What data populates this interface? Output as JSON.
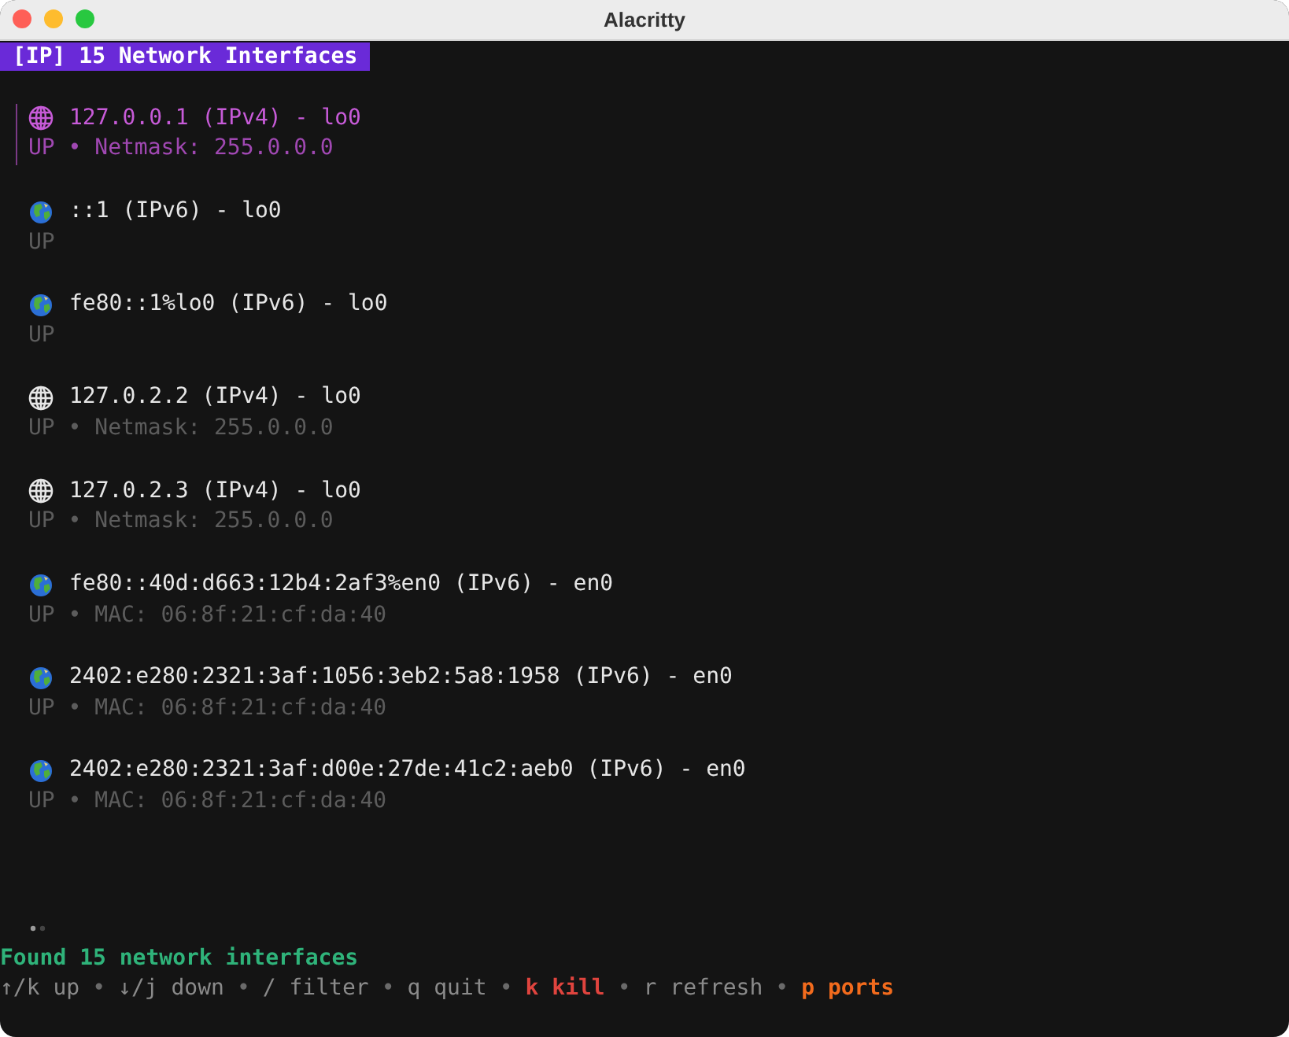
{
  "window": {
    "title": "Alacritty"
  },
  "header": "[IP] 15 Network Interfaces",
  "interfaces": [
    {
      "kind": "ipv4",
      "selected": true,
      "address": "127.0.0.1 (IPv4) - lo0",
      "status": "UP • Netmask: 255.0.0.0"
    },
    {
      "kind": "ipv6",
      "selected": false,
      "address": "::1 (IPv6) - lo0",
      "status": "UP"
    },
    {
      "kind": "ipv6",
      "selected": false,
      "address": "fe80::1%lo0 (IPv6) - lo0",
      "status": "UP"
    },
    {
      "kind": "ipv4",
      "selected": false,
      "address": "127.0.2.2 (IPv4) - lo0",
      "status": "UP • Netmask: 255.0.0.0"
    },
    {
      "kind": "ipv4",
      "selected": false,
      "address": "127.0.2.3 (IPv4) - lo0",
      "status": "UP • Netmask: 255.0.0.0"
    },
    {
      "kind": "ipv6",
      "selected": false,
      "address": "fe80::40d:d663:12b4:2af3%en0 (IPv6) - en0",
      "status": "UP • MAC: 06:8f:21:cf:da:40"
    },
    {
      "kind": "ipv6",
      "selected": false,
      "address": "2402:e280:2321:3af:1056:3eb2:5a8:1958 (IPv6) - en0",
      "status": "UP • MAC: 06:8f:21:cf:da:40"
    },
    {
      "kind": "ipv6",
      "selected": false,
      "address": "2402:e280:2321:3af:d00e:27de:41c2:aeb0 (IPv6) - en0",
      "status": "UP • MAC: 06:8f:21:cf:da:40"
    }
  ],
  "summary": "Found 15 network interfaces",
  "help": {
    "separator": "•",
    "items": [
      {
        "text": "↑/k up",
        "kind": "normal"
      },
      {
        "text": "↓/j down",
        "kind": "normal"
      },
      {
        "text": "/ filter",
        "kind": "normal"
      },
      {
        "text": "q quit",
        "kind": "normal"
      },
      {
        "text": "k kill",
        "kind": "danger"
      },
      {
        "text": "r refresh",
        "kind": "normal"
      },
      {
        "text": "p ports",
        "kind": "warning"
      }
    ]
  }
}
